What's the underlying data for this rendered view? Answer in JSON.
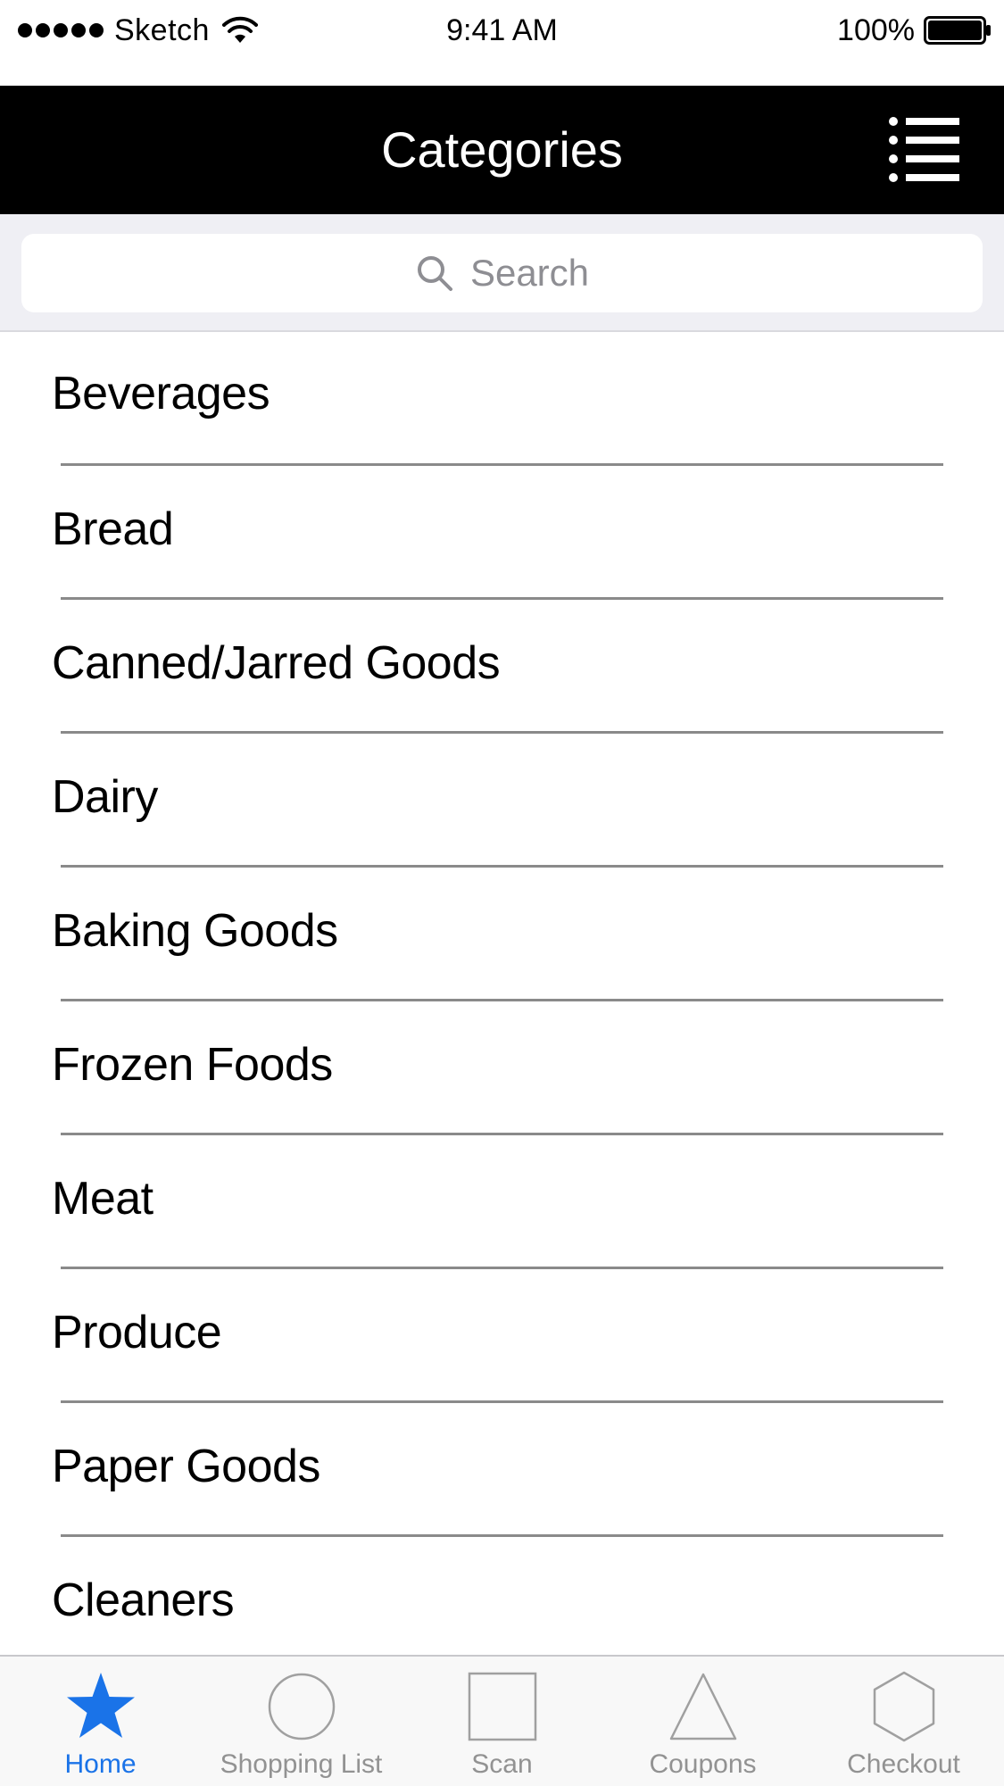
{
  "status_bar": {
    "carrier": "Sketch",
    "time": "9:41 AM",
    "battery": "100%"
  },
  "nav": {
    "title": "Categories",
    "menu_icon": "list-menu-icon"
  },
  "search": {
    "placeholder": "Search",
    "icon": "search-icon"
  },
  "categories": [
    {
      "label": "Beverages"
    },
    {
      "label": "Bread"
    },
    {
      "label": "Canned/Jarred Goods"
    },
    {
      "label": "Dairy"
    },
    {
      "label": "Baking Goods"
    },
    {
      "label": "Frozen Foods"
    },
    {
      "label": "Meat"
    },
    {
      "label": "Produce"
    },
    {
      "label": "Paper Goods"
    },
    {
      "label": "Cleaners"
    }
  ],
  "tabs": [
    {
      "label": "Home",
      "icon": "star-icon",
      "active": true
    },
    {
      "label": "Shopping List",
      "icon": "circle-icon",
      "active": false
    },
    {
      "label": "Scan",
      "icon": "square-icon",
      "active": false
    },
    {
      "label": "Coupons",
      "icon": "triangle-icon",
      "active": false
    },
    {
      "label": "Checkout",
      "icon": "hexagon-icon",
      "active": false
    }
  ],
  "colors": {
    "accent": "#1a73e8",
    "nav_background": "#000000",
    "tab_inactive": "#929292",
    "search_background": "#efeff4"
  }
}
